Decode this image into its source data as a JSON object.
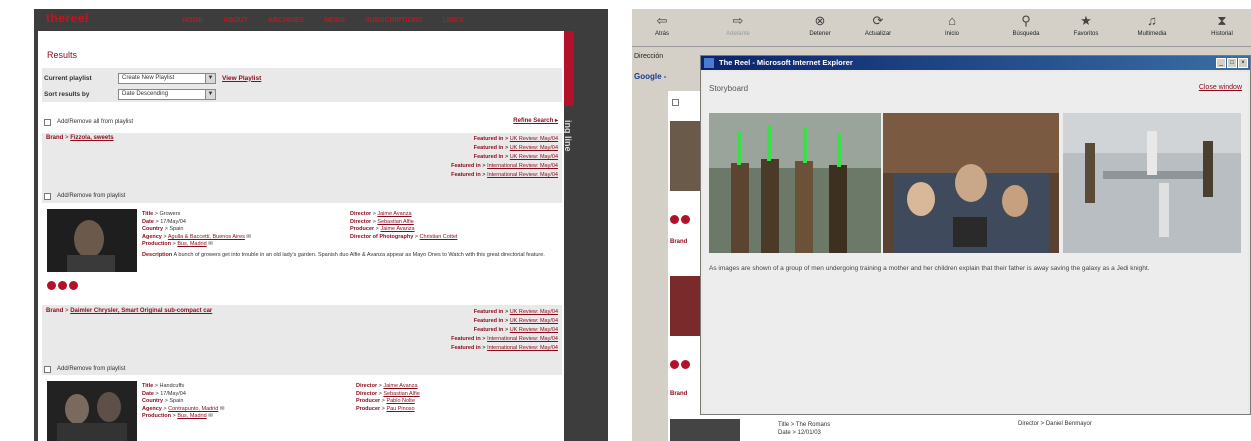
{
  "left": {
    "site_logo": "thereel",
    "nav": [
      "HOME",
      "ABOUT",
      "ARCHIVES",
      "NEWS",
      "SUBSCRIPTIONS",
      "LINKS"
    ],
    "results_title": "Results",
    "current_playlist_label": "Current playlist",
    "playlist_select_value": "Create New Playlist",
    "view_playlist_link": "View Playlist",
    "sort_label": "Sort results by",
    "sort_select_value": "Date Descending",
    "add_remove_all": "Add/Remove all from playlist",
    "rail_text": "ing line",
    "entries": [
      {
        "brand_label": "Brand",
        "brand_value": "Fizzola, sweets",
        "featured": [
          {
            "label": "Featured in",
            "value": "UK Review: May/04"
          },
          {
            "label": "Featured in",
            "value": "UK Review: May/04"
          },
          {
            "label": "Featured in",
            "value": "UK Review: May/04"
          },
          {
            "label": "Featured in",
            "value": "International Review: May/04"
          },
          {
            "label": "Featured in",
            "value": "International Review: May/04"
          }
        ],
        "add_remove": "Add/Remove from playlist",
        "title": "Growers",
        "date": "17/May/04",
        "country": "Spain",
        "agency": "Agulla & Baccetti, Buenos Aires",
        "production": "Bus, Madrid",
        "director1": "Jaime Avanza",
        "director2": "Sebastian Alfie",
        "producer": "Jaime Avanza",
        "dop": "Christian Cottet",
        "description_label": "Description",
        "description": "A bunch of growers get into trouble in an old lady's garden. Spanish duo Alfie & Avanza appear as Mayo Ones to Watch with this great directorial feature."
      },
      {
        "brand_label": "Brand",
        "brand_value": "Daimler Chrysler, Smart Original sub-compact car",
        "featured": [
          {
            "label": "Featured in",
            "value": "UK Review: May/04"
          },
          {
            "label": "Featured in",
            "value": "UK Review: May/04"
          },
          {
            "label": "Featured in",
            "value": "UK Review: May/04"
          },
          {
            "label": "Featured in",
            "value": "International Review: May/04"
          },
          {
            "label": "Featured in",
            "value": "International Review: May/04"
          }
        ],
        "add_remove": "Add/Remove from playlist",
        "title": "Handcuffs",
        "date": "17/May/04",
        "country": "Spain",
        "agency": "Contrapunto, Madrid",
        "production": "Bus, Madrid",
        "director1": "Jaime Avanza",
        "director2": "Sebastian Alfie",
        "producer": "Pablo Nolte",
        "producer2": "Pau Pinoso"
      }
    ]
  },
  "right": {
    "toolbar": [
      {
        "label": "Atrás",
        "icon": "back-arrow-icon",
        "glyph": "⇦"
      },
      {
        "label": "Adelante",
        "icon": "forward-arrow-icon",
        "glyph": "⇨"
      },
      {
        "label": "Detener",
        "icon": "stop-icon",
        "glyph": "⊗"
      },
      {
        "label": "Actualizar",
        "icon": "refresh-icon",
        "glyph": "⟳"
      },
      {
        "label": "Inicio",
        "icon": "home-icon",
        "glyph": "⌂"
      },
      {
        "label": "Búsqueda",
        "icon": "search-icon",
        "glyph": "⚲"
      },
      {
        "label": "Favoritos",
        "icon": "favorites-icon",
        "glyph": "★"
      },
      {
        "label": "Multimedia",
        "icon": "multimedia-icon",
        "glyph": "♫"
      },
      {
        "label": "Historial",
        "icon": "history-icon",
        "glyph": "⧗"
      }
    ],
    "address_label": "Dirección",
    "google_label": "Google -",
    "window_title": "The Reel - Microsoft Internet Explorer",
    "storyboard_title": "Storyboard",
    "close_window": "Close window",
    "storyboard_description": "As images are shown of a group of men undergoing training a mother and her children explain that their father is away saving the galaxy as a Jedi knight.",
    "lower_title": "Title > The Romans",
    "lower_date": "Date > 12/01/03",
    "lower_director": "Director > Daniel Benmayor"
  }
}
